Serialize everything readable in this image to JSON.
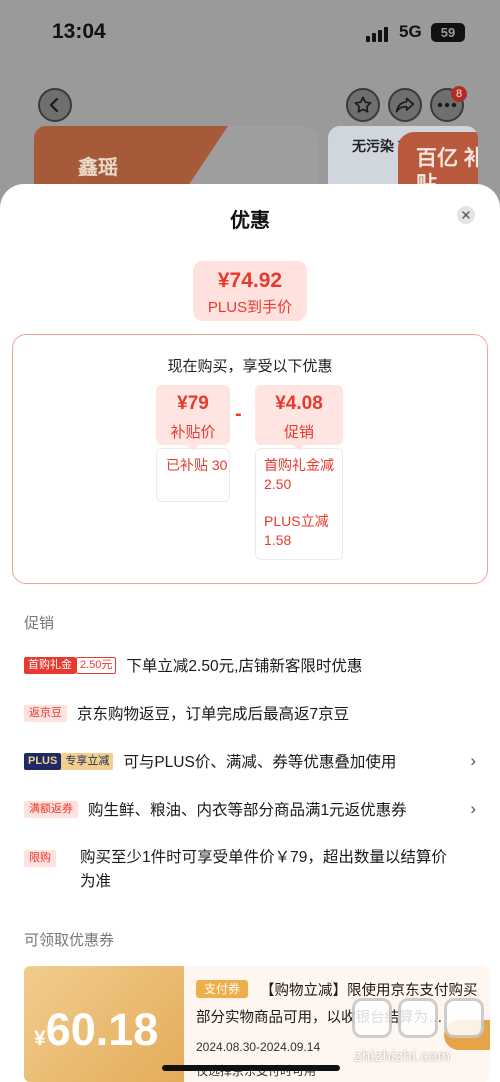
{
  "status_bar": {
    "time": "13:04",
    "network": "5G",
    "battery": "59"
  },
  "background": {
    "banner_left_logo": "鑫瑶",
    "banner_right_text": "无污染 放",
    "banner_right_badge": "百亿 补贴"
  },
  "nav": {
    "back_icon": "chevron-left-icon",
    "fav_icon": "star-icon",
    "share_icon": "share-icon",
    "more_icon": "more-icon",
    "more_badge": "8"
  },
  "sheet": {
    "title": "优惠",
    "close_icon": "close-icon",
    "final_price": {
      "amount": "¥74.92",
      "label": "PLUS到手价"
    },
    "breakdown": {
      "title": "现在购买，享受以下优惠",
      "subsidy": {
        "amount": "¥79",
        "label": "补贴价",
        "detail": "已补贴 30"
      },
      "operator": "-",
      "promo": {
        "amount": "¥4.08",
        "label": "促销",
        "detail_1": "首购礼金减2.50",
        "detail_2": "PLUS立减1.58"
      }
    }
  },
  "promotions": {
    "section_label": "促销",
    "rows": [
      {
        "tag": "首购礼金",
        "tag_extra": "2.50元",
        "text": "下单立减2.50元,店铺新客限时优惠"
      },
      {
        "tag": "返京豆",
        "text": "京东购物返豆，订单完成后最高返7京豆"
      },
      {
        "tag": "PLUS",
        "tag_extra": "专享立减",
        "text": "可与PLUS价、满减、券等优惠叠加使用",
        "arrow": "›"
      },
      {
        "tag": "满额返券",
        "text": "购生鲜、粮油、内衣等部分商品满1元返优惠券",
        "arrow": "›"
      },
      {
        "tag": "限购",
        "text": "购买至少1件时可享受单件价￥79，超出数量以结算价为准"
      }
    ]
  },
  "coupons": {
    "section_label": "可领取优惠券",
    "items": [
      {
        "currency": "¥",
        "amount": "60.18",
        "tag": "支付券",
        "description": "【购物立减】限使用京东支付购买部分实物商品可用，以收银台结算为…",
        "date_range": "2024.08.30-2024.09.14",
        "note": "仅选择京东支付时可用"
      }
    ]
  },
  "watermark": {
    "text": "zhizhizhi.com"
  },
  "colors": {
    "accent": "#e9392f",
    "accent_light": "#ffe1de",
    "plus_navy": "#1c2a66",
    "plus_gold": "#f2d08c",
    "coupon_gold": "#e4ac5a"
  }
}
